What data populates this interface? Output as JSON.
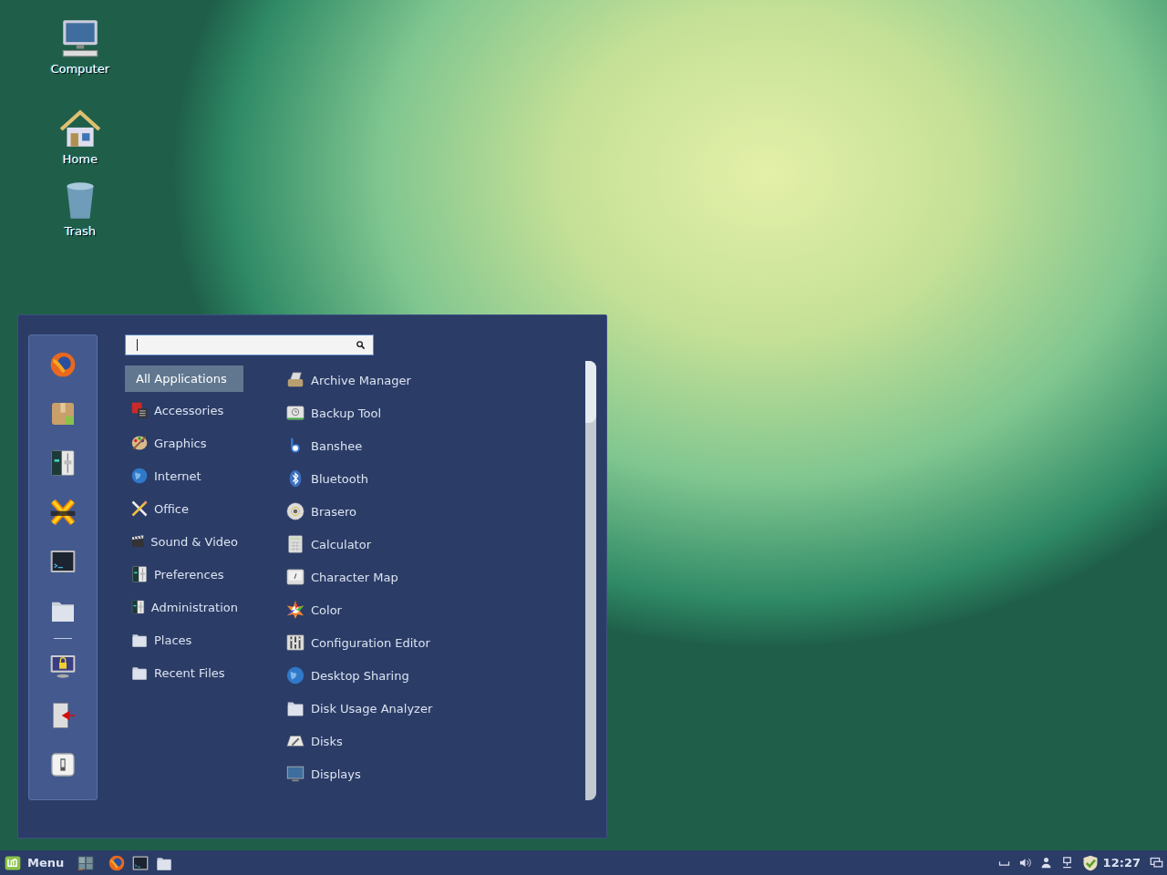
{
  "desktop_icons": [
    {
      "label": "Computer",
      "kind": "computer"
    },
    {
      "label": "Home",
      "kind": "home"
    },
    {
      "label": "Trash",
      "kind": "trash"
    }
  ],
  "menu": {
    "favorites": [
      {
        "kind": "browser"
      },
      {
        "kind": "package"
      },
      {
        "kind": "settings"
      },
      {
        "kind": "chat"
      },
      {
        "kind": "terminal"
      },
      {
        "kind": "folder"
      },
      {
        "kind": "separator"
      },
      {
        "kind": "lock"
      },
      {
        "kind": "logout"
      },
      {
        "kind": "power"
      }
    ],
    "categories": [
      {
        "label": "All Applications",
        "kind": "none",
        "selected": true
      },
      {
        "label": "Accessories",
        "kind": "accessories",
        "selected": false
      },
      {
        "label": "Graphics",
        "kind": "palette",
        "selected": false
      },
      {
        "label": "Internet",
        "kind": "globe",
        "selected": false
      },
      {
        "label": "Office",
        "kind": "office",
        "selected": false
      },
      {
        "label": "Sound & Video",
        "kind": "clapper",
        "selected": false
      },
      {
        "label": "Preferences",
        "kind": "settings",
        "selected": false
      },
      {
        "label": "Administration",
        "kind": "settings",
        "selected": false
      },
      {
        "label": "Places",
        "kind": "folder",
        "selected": false
      },
      {
        "label": "Recent Files",
        "kind": "folder",
        "selected": false
      }
    ],
    "apps": [
      {
        "label": "Archive Manager",
        "kind": "archive"
      },
      {
        "label": "Backup Tool",
        "kind": "backup"
      },
      {
        "label": "Banshee",
        "kind": "banshee"
      },
      {
        "label": "Bluetooth",
        "kind": "bluetooth"
      },
      {
        "label": "Brasero",
        "kind": "disc"
      },
      {
        "label": "Calculator",
        "kind": "calculator"
      },
      {
        "label": "Character Map",
        "kind": "charmap"
      },
      {
        "label": "Color",
        "kind": "color"
      },
      {
        "label": "Configuration Editor",
        "kind": "config"
      },
      {
        "label": "Desktop Sharing",
        "kind": "globe"
      },
      {
        "label": "Disk Usage Analyzer",
        "kind": "folder"
      },
      {
        "label": "Disks",
        "kind": "disks"
      },
      {
        "label": "Displays",
        "kind": "monitor"
      }
    ]
  },
  "taskbar": {
    "menu_label": "Menu",
    "launchers": [
      {
        "kind": "workspace"
      },
      {
        "kind": "browser"
      },
      {
        "kind": "terminal"
      },
      {
        "kind": "folder"
      }
    ],
    "tray": [
      {
        "kind": "keyboard"
      },
      {
        "kind": "volume"
      },
      {
        "kind": "user"
      },
      {
        "kind": "network"
      },
      {
        "kind": "shield"
      }
    ],
    "clock": "12:27",
    "end_icons": [
      {
        "kind": "desktop"
      }
    ]
  }
}
